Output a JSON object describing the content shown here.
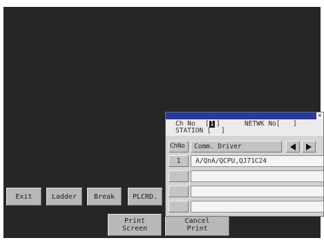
{
  "buttons": {
    "exit": "Exit",
    "ladder": "Ladder",
    "break": "Break",
    "plcrd": "PLCRD.",
    "print_screen": "Print\nScreen",
    "cancel_print": "Cancel\nPrint"
  },
  "panel": {
    "close": "×",
    "ch_no_label": "Ch No",
    "ch_open": "[",
    "ch_value": "1",
    "ch_close": "]",
    "netwk_label": "NETWK No[",
    "netwk_close": "]",
    "station_label": "STATION [",
    "station_close": "]",
    "col_chno": "ChNo",
    "col_driver": "Comm. Driver",
    "rows": [
      {
        "chno": "1",
        "driver": "A/QnA/QCPU,QJ71C24"
      },
      {
        "chno": "",
        "driver": ""
      },
      {
        "chno": "",
        "driver": ""
      },
      {
        "chno": "",
        "driver": ""
      }
    ]
  },
  "icons": {
    "left": "triangle-left-icon",
    "right": "triangle-right-icon"
  },
  "colors": {
    "background": "#262626",
    "titlebar": "#283a9a",
    "button": "#b8b8b8"
  }
}
